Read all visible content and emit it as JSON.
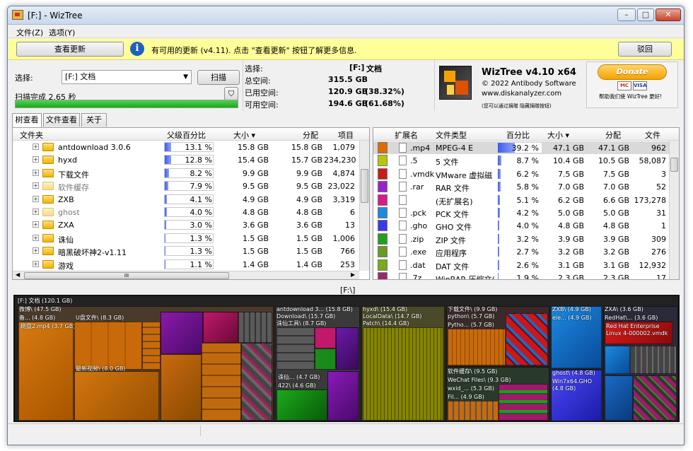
{
  "window": {
    "title": "[F:]  - WizTree"
  },
  "menu": [
    "文件(Z)",
    "选项(Y)"
  ],
  "update": {
    "check_button": "查看更新",
    "message": "有可用的更新 (v4.11). 点击 \"查看更新\" 按钮了解更多信息.",
    "dismiss_button": "驳回"
  },
  "scan": {
    "select_label": "选择:",
    "drive_value": "[F:] 文档",
    "scan_button": "扫描",
    "status": "扫描完成 2.65 秒"
  },
  "stats": {
    "select_label": "选择:",
    "drive": "[F:]",
    "drive_name": "文档",
    "total_label": "总空间:",
    "total": "315.5 GB",
    "used_label": "已用空间:",
    "used": "120.9 GB",
    "used_pct": "(38.32%)",
    "free_label": "可用空间:",
    "free": "194.6 GB",
    "free_pct": "(61.68%)"
  },
  "about": {
    "product": "WizTree v4.10 x64",
    "copyright": "© 2022 Antibody Software",
    "website": "www.diskanalyzer.com",
    "note": "(您可以通过捐赠 隐藏捐赠按钮)"
  },
  "donate": {
    "button": "Donate",
    "cards": [
      "MC",
      "VISA"
    ],
    "caption": "帮助我们使 WizTree 更好!"
  },
  "tabs": [
    "树查看",
    "文件查看",
    "关于"
  ],
  "tree": {
    "columns": [
      "文件夹",
      "父级百分比",
      "大小 ▾",
      "分配",
      "项目"
    ],
    "rows": [
      {
        "name": "antdownload 3.0.6",
        "pct": "13.1 %",
        "pct_value": 13.1,
        "size": "15.8 GB",
        "alloc": "15.8 GB",
        "items": "1,079",
        "dim": false
      },
      {
        "name": "hyxd",
        "pct": "12.8 %",
        "pct_value": 12.8,
        "size": "15.4 GB",
        "alloc": "15.7 GB",
        "items": "234,230",
        "dim": false
      },
      {
        "name": "下载文件",
        "pct": "8.2 %",
        "pct_value": 8.2,
        "size": "9.9 GB",
        "alloc": "9.9 GB",
        "items": "4,874",
        "dim": false
      },
      {
        "name": "软件缓存",
        "pct": "7.9 %",
        "pct_value": 7.9,
        "size": "9.5 GB",
        "alloc": "9.5 GB",
        "items": "23,022",
        "dim": true
      },
      {
        "name": "ZXB",
        "pct": "4.1 %",
        "pct_value": 4.1,
        "size": "4.9 GB",
        "alloc": "4.9 GB",
        "items": "3,319",
        "dim": false
      },
      {
        "name": "ghost",
        "pct": "4.0 %",
        "pct_value": 4.0,
        "size": "4.8 GB",
        "alloc": "4.8 GB",
        "items": "6",
        "dim": true
      },
      {
        "name": "ZXA",
        "pct": "3.0 %",
        "pct_value": 3.0,
        "size": "3.6 GB",
        "alloc": "3.6 GB",
        "items": "13",
        "dim": false
      },
      {
        "name": "诛仙",
        "pct": "1.3 %",
        "pct_value": 1.3,
        "size": "1.5 GB",
        "alloc": "1.5 GB",
        "items": "1,006",
        "dim": false
      },
      {
        "name": "暗黑破坏神2-v1.11",
        "pct": "1.3 %",
        "pct_value": 1.3,
        "size": "1.5 GB",
        "alloc": "1.5 GB",
        "items": "766",
        "dim": false
      },
      {
        "name": "游戏",
        "pct": "1.1 %",
        "pct_value": 1.1,
        "size": "1.4 GB",
        "alloc": "1.4 GB",
        "items": "253",
        "dim": false
      }
    ],
    "hscroll_grip": "III"
  },
  "ext": {
    "columns": [
      "扩展名",
      "文件类型",
      "百分比",
      "大小 ▾",
      "分配",
      "文件"
    ],
    "rows": [
      {
        "color": "#e06a00",
        "ext": ".mp4",
        "type": "MPEG-4 E",
        "pct": "39.2 %",
        "pct_value": 39.2,
        "size": "47.1 GB",
        "alloc": "47.1 GB",
        "files": "962",
        "selected": true
      },
      {
        "color": "#b8c800",
        "ext": ".5",
        "type": "5 文件",
        "pct": "8.7 %",
        "pct_value": 8.7,
        "size": "10.4 GB",
        "alloc": "10.5 GB",
        "files": "58,087",
        "selected": false
      },
      {
        "color": "#cc1a1a",
        "ext": ".vmdk",
        "type": "VMware 虚拟磁",
        "pct": "6.2 %",
        "pct_value": 6.2,
        "size": "7.5 GB",
        "alloc": "7.5 GB",
        "files": "3",
        "selected": false
      },
      {
        "color": "#9a22c8",
        "ext": ".rar",
        "type": "RAR 文件",
        "pct": "5.8 %",
        "pct_value": 5.8,
        "size": "7.0 GB",
        "alloc": "7.0 GB",
        "files": "52",
        "selected": false
      },
      {
        "color": "#d81a8a",
        "ext": "",
        "type": "(无扩展名)",
        "pct": "5.1 %",
        "pct_value": 5.1,
        "size": "6.2 GB",
        "alloc": "6.6 GB",
        "files": "173,278",
        "selected": false
      },
      {
        "color": "#1a8ae0",
        "ext": ".pck",
        "type": "PCK 文件",
        "pct": "4.2 %",
        "pct_value": 4.2,
        "size": "5.0 GB",
        "alloc": "5.0 GB",
        "files": "31",
        "selected": false
      },
      {
        "color": "#3a3ae8",
        "ext": ".gho",
        "type": "GHO 文件",
        "pct": "4.0 %",
        "pct_value": 4.0,
        "size": "4.8 GB",
        "alloc": "4.8 GB",
        "files": "1",
        "selected": false
      },
      {
        "color": "#22a022",
        "ext": ".zip",
        "type": "ZIP 文件",
        "pct": "3.2 %",
        "pct_value": 3.2,
        "size": "3.9 GB",
        "alloc": "3.9 GB",
        "files": "309",
        "selected": false
      },
      {
        "color": "#6a9a22",
        "ext": ".exe",
        "type": "应用程序",
        "pct": "2.7 %",
        "pct_value": 2.7,
        "size": "3.2 GB",
        "alloc": "3.2 GB",
        "files": "276",
        "selected": false
      },
      {
        "color": "#7aaa1a",
        "ext": ".dat",
        "type": "DAT 文件",
        "pct": "2.6 %",
        "pct_value": 2.6,
        "size": "3.1 GB",
        "alloc": "3.1 GB",
        "files": "12,932",
        "selected": false
      },
      {
        "color": "#9a2a6a",
        "ext": ".7z",
        "type": "WinRAR 压缩文(",
        "pct": "1.9 %",
        "pct_value": 1.9,
        "size": "2.3 GB",
        "alloc": "2.3 GB",
        "files": "17",
        "selected": false
      }
    ]
  },
  "treemap": {
    "path": "[F:\\]",
    "root_label": "[F:] 文档 (120.1 GB)",
    "labels": {
      "l_a": "微博\\ (47.5 GB)",
      "l_b": "备... (4.8 GB)",
      "l_c": "刷盘2.mp4 (3.7 GB)",
      "l_d": "U盘文件\\ (8.3 GB)",
      "l_e": "最新视频\\ (8.0 GB)",
      "l_f": "antdownload 3... (15.8 GB)",
      "l_g": "Download\\ (15.7 GB)",
      "l_h": "诛仙工具\\ (8.7 GB)",
      "l_i": "诛仙... (4.7 GB)",
      "l_j": "422\\ (4.6 GB)",
      "l_k": "hyxd\\ (15.4 GB)",
      "l_l": "LocalData\\ (14.7 GB)",
      "l_m": "Patch\\ (14.4 GB)",
      "l_n": "下载文件\\ (9.9 GB)",
      "l_o": "python\\ (5.7 GB)",
      "l_p": "Pytho... (5.7 GB)",
      "l_q": "软件缓存\\ (9.5 GB)",
      "l_r": "WeChat Files\\ (9.3 GB)",
      "l_s": "wxid_... (5.3 GB)",
      "l_t": "Fil... (4.9 GB)",
      "l_u": "ZXB\\ (4.9 GB)",
      "l_v": "ele... (4.9 GB)",
      "l_w": "ghost\\ (4.8 GB)",
      "l_x": "Win7x64.GHO (4.8 GB)",
      "l_y": "ZXA\\ (3.6 GB)",
      "l_z": "RedHat\\... (3.6 GB)",
      "l_aa": "Red Hat Enterprise Linux 4-000002.vmdk"
    }
  }
}
